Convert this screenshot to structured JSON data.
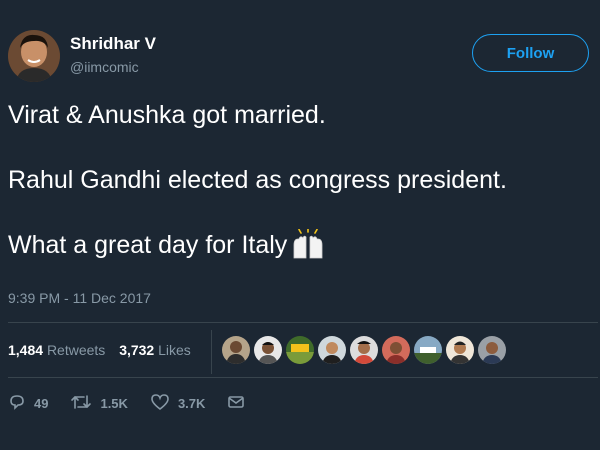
{
  "author": {
    "display_name": "Shridhar V",
    "handle": "@iimcomic"
  },
  "follow_label": "Follow",
  "tweet": {
    "lines": [
      "Virat & Anushka got married.",
      "Rahul Gandhi elected as congress president.",
      "What a great day for Italy"
    ],
    "emoji": "raising-hands-icon"
  },
  "timestamp": "9:39 PM - 11 Dec 2017",
  "stats": {
    "retweets_count": "1,484",
    "retweets_label": "Retweets",
    "likes_count": "3,732",
    "likes_label": "Likes"
  },
  "actions": {
    "replies": "49",
    "retweets": "1.5K",
    "likes": "3.7K"
  },
  "colors": {
    "background": "#1c2733",
    "accent": "#1da1f2",
    "muted": "#8899a6",
    "divider": "#38444d"
  }
}
